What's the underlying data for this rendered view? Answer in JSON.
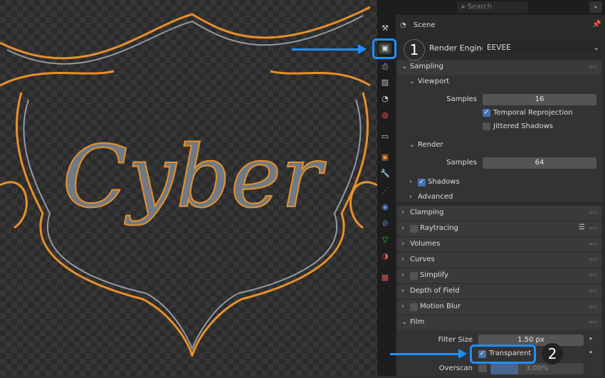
{
  "header": {
    "search_placeholder": "Search",
    "context": "Scene"
  },
  "render_engine": {
    "label": "Render Engine",
    "value": "EEVEE"
  },
  "sampling": {
    "label": "Sampling",
    "viewport": {
      "label": "Viewport",
      "samples_label": "Samples",
      "samples": "16",
      "temporal_reprojection": {
        "label": "Temporal Reprojection",
        "checked": true
      },
      "jittered_shadows": {
        "label": "Jittered Shadows",
        "checked": false
      }
    },
    "render": {
      "label": "Render",
      "samples_label": "Samples",
      "samples": "64"
    },
    "shadows": {
      "label": "Shadows",
      "checked": true
    },
    "advanced": {
      "label": "Advanced"
    }
  },
  "sections": {
    "clamping": "Clamping",
    "raytracing": "Raytracing",
    "volumes": "Volumes",
    "curves": "Curves",
    "simplify": "Simplify",
    "depth_of_field": "Depth of Field",
    "motion_blur": "Motion Blur"
  },
  "film": {
    "label": "Film",
    "filter_size_label": "Filter Size",
    "filter_size": "1.50 px",
    "transparent": {
      "label": "Transparent",
      "checked": true
    },
    "overscan_label": "Overscan",
    "overscan": "3.00%",
    "overscan_fraction": 0.03
  },
  "annotations": {
    "step1": "1",
    "step2": "2"
  },
  "viewport_art": {
    "text": "Cyber"
  },
  "colors": {
    "accent": "#4772b3",
    "highlight": "#1e90ff",
    "outline": "#e8902a"
  }
}
